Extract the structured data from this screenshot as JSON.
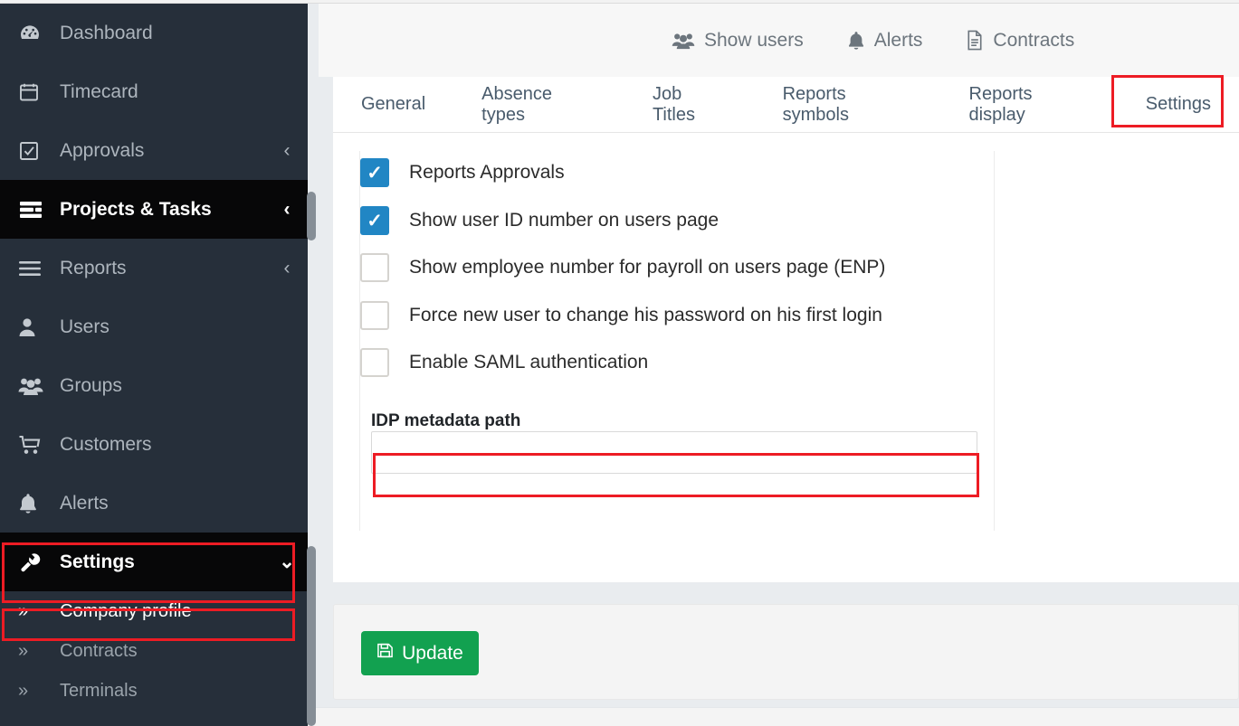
{
  "sidebar": {
    "items": [
      {
        "label": "Dashboard",
        "icon": "dashboard-icon",
        "chevron": "",
        "active": false
      },
      {
        "label": "Timecard",
        "icon": "calendar-icon",
        "chevron": "",
        "active": false
      },
      {
        "label": "Approvals",
        "icon": "check-square-icon",
        "chevron": "‹",
        "active": false
      },
      {
        "label": "Projects & Tasks",
        "icon": "tasks-icon",
        "chevron": "‹",
        "active": true
      },
      {
        "label": "Reports",
        "icon": "bars-icon",
        "chevron": "‹",
        "active": false
      },
      {
        "label": "Users",
        "icon": "user-icon",
        "chevron": "",
        "active": false
      },
      {
        "label": "Groups",
        "icon": "users-icon",
        "chevron": "",
        "active": false
      },
      {
        "label": "Customers",
        "icon": "cart-icon",
        "chevron": "",
        "active": false
      },
      {
        "label": "Alerts",
        "icon": "bell-icon",
        "chevron": "",
        "active": false
      },
      {
        "label": "Settings",
        "icon": "wrench-icon",
        "chevron": "⌄",
        "active": true
      }
    ],
    "sub_items": [
      {
        "label": "Company profile",
        "icon": "»",
        "current": true
      },
      {
        "label": "Contracts",
        "icon": "»",
        "current": false
      },
      {
        "label": "Terminals",
        "icon": "»",
        "current": false
      }
    ]
  },
  "topbar": {
    "links": [
      {
        "label": "Show users",
        "icon": "users-icon"
      },
      {
        "label": "Alerts",
        "icon": "bell-icon"
      },
      {
        "label": "Contracts",
        "icon": "document-icon"
      }
    ]
  },
  "tabs": [
    {
      "label": "General",
      "active": false
    },
    {
      "label": "Absence types",
      "active": false
    },
    {
      "label": "Job Titles",
      "active": false
    },
    {
      "label": "Reports symbols",
      "active": false
    },
    {
      "label": "Reports display",
      "active": false
    },
    {
      "label": "Settings",
      "active": true
    }
  ],
  "settings": {
    "checkboxes": [
      {
        "label": "Reports Approvals",
        "checked": true
      },
      {
        "label": "Show user ID number on users page",
        "checked": true
      },
      {
        "label": "Show employee number for payroll on users page (ENP)",
        "checked": false
      },
      {
        "label": "Force new user to change his password on his first login",
        "checked": false
      },
      {
        "label": "Enable SAML authentication",
        "checked": false
      }
    ],
    "idp_label": "IDP metadata path",
    "idp_value": "",
    "idp_placeholder": ""
  },
  "footer": {
    "update_label": "Update",
    "update_icon": "save-icon"
  },
  "colors": {
    "sidebar_bg": "#262f3a",
    "sidebar_active_bg": "#070708",
    "checkbox_on": "#2186c4",
    "update_green": "#12a150",
    "annotation_red": "#ed1c24"
  }
}
